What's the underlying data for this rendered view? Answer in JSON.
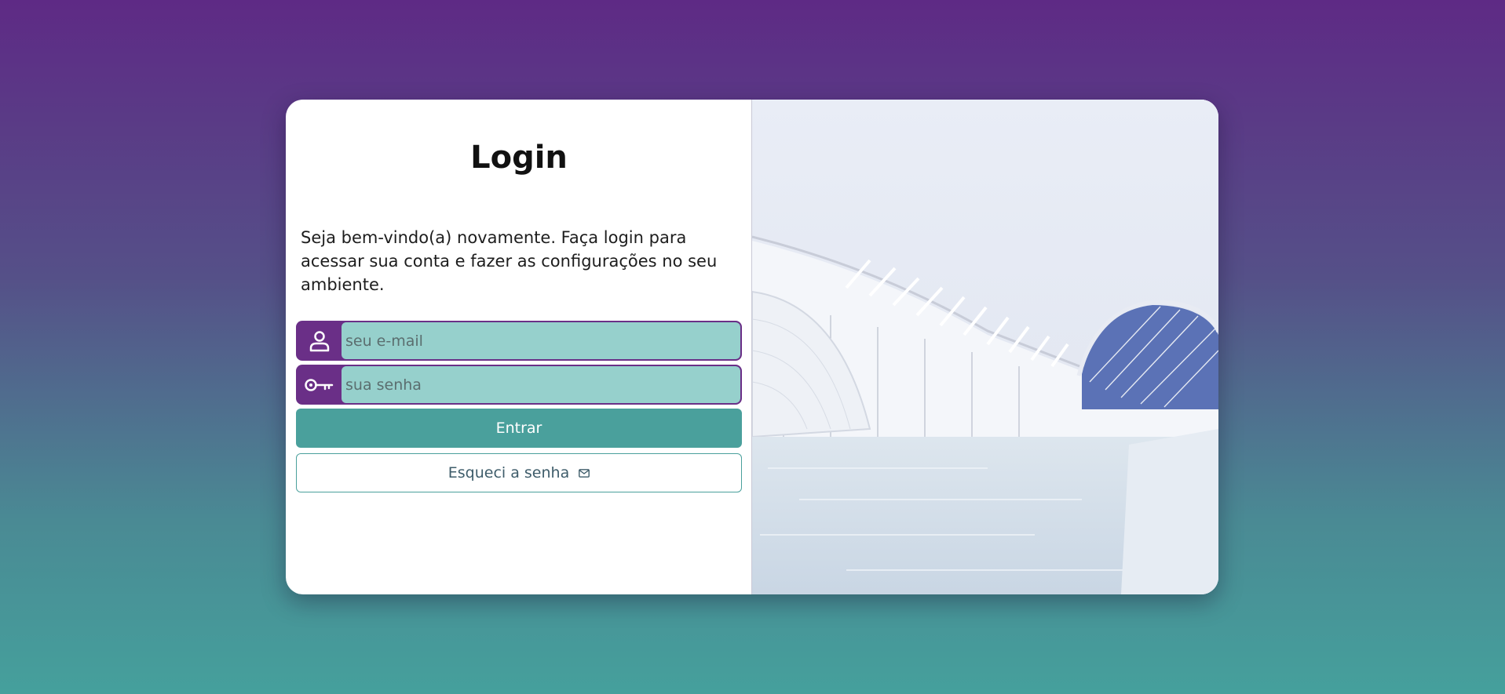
{
  "login": {
    "title": "Login",
    "description": "Seja bem-vindo(a) novamente. Faça login para acessar sua conta e fazer as configurações no seu ambiente.",
    "email": {
      "placeholder": "seu e-mail",
      "icon": "user-icon"
    },
    "password": {
      "placeholder": "sua senha",
      "icon": "key-icon"
    },
    "submit_label": "Entrar",
    "forgot_label": "Esqueci a senha",
    "forgot_icon": "mail-icon"
  },
  "colors": {
    "brand_purple": "#6a2f87",
    "accent_teal": "#4aa09c",
    "input_fill": "#96d0cc"
  }
}
